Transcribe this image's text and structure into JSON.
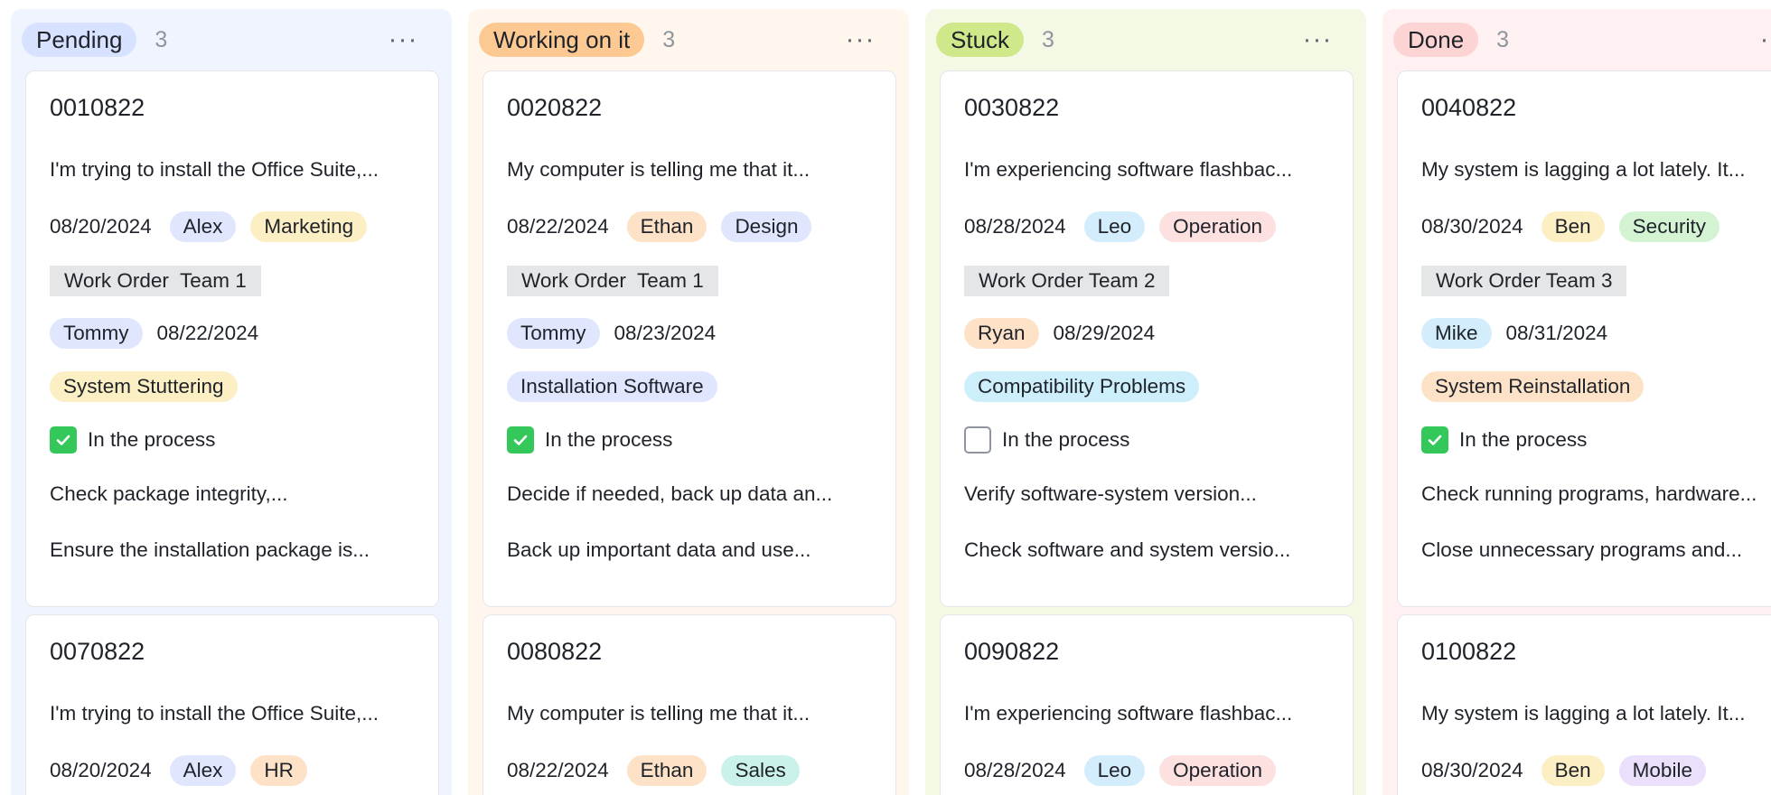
{
  "columns": [
    {
      "status": "Pending",
      "count": "3",
      "pill_color": "#d6e2ff",
      "bg_color": "#f0f4ff",
      "cards": [
        {
          "id": "0010822",
          "description": "I'm trying to install the Office Suite,...",
          "date": "08/20/2024",
          "assignee": {
            "name": "Alex",
            "color": "#dfe6fd"
          },
          "department": {
            "name": "Marketing",
            "color": "#fcefc4"
          },
          "work_order": "Work Order  Team 1",
          "handler": {
            "name": "Tommy",
            "color": "#dfe6fd"
          },
          "handler_date": "08/22/2024",
          "category": {
            "name": "System Stuttering",
            "color": "#fcefc4"
          },
          "process_checked": true,
          "process_label": "In the process",
          "step1": "Check package integrity,...",
          "step2": "Ensure the installation package is..."
        },
        {
          "id": "0070822",
          "description": "I'm trying to install the Office Suite,...",
          "date": "08/20/2024",
          "assignee": {
            "name": "Alex",
            "color": "#dfe6fd"
          },
          "department": {
            "name": "HR",
            "color": "#fde2c8"
          }
        }
      ]
    },
    {
      "status": "Working on it",
      "count": "3",
      "pill_color": "#fdc993",
      "bg_color": "#fff6ed",
      "cards": [
        {
          "id": "0020822",
          "description": "My computer is telling me that it...",
          "date": "08/22/2024",
          "assignee": {
            "name": "Ethan",
            "color": "#fde2c8"
          },
          "department": {
            "name": "Design",
            "color": "#dfe6fd"
          },
          "work_order": "Work Order  Team 1",
          "handler": {
            "name": "Tommy",
            "color": "#dfe6fd"
          },
          "handler_date": "08/23/2024",
          "category": {
            "name": "Installation Software",
            "color": "#dfe6fd"
          },
          "process_checked": true,
          "process_label": "In the process",
          "step1": "Decide if needed, back up data an...",
          "step2": "Back up important data and use..."
        },
        {
          "id": "0080822",
          "description": "My computer is telling me that it...",
          "date": "08/22/2024",
          "assignee": {
            "name": "Ethan",
            "color": "#fde2c8"
          },
          "department": {
            "name": "Sales",
            "color": "#caf2ea"
          }
        }
      ]
    },
    {
      "status": "Stuck",
      "count": "3",
      "pill_color": "#cfe88a",
      "bg_color": "#f4f9e6",
      "cards": [
        {
          "id": "0030822",
          "description": "I'm experiencing software flashbac...",
          "date": "08/28/2024",
          "assignee": {
            "name": "Leo",
            "color": "#d3edfc"
          },
          "department": {
            "name": "Operation",
            "color": "#fde0e0"
          },
          "work_order": "Work Order Team 2",
          "handler": {
            "name": "Ryan",
            "color": "#fde2c8"
          },
          "handler_date": "08/29/2024",
          "category": {
            "name": "Compatibility Problems",
            "color": "#cdeefb"
          },
          "process_checked": false,
          "process_label": "In the process",
          "step1": "Verify software-system version...",
          "step2": "Check software and system versio..."
        },
        {
          "id": "0090822",
          "description": "I'm experiencing software flashbac...",
          "date": "08/28/2024",
          "assignee": {
            "name": "Leo",
            "color": "#d3edfc"
          },
          "department": {
            "name": "Operation",
            "color": "#fde0e0"
          }
        }
      ]
    },
    {
      "status": "Done",
      "count": "3",
      "pill_color": "#fdd4d4",
      "bg_color": "#fff1f1",
      "cards": [
        {
          "id": "0040822",
          "description": "My system is lagging a lot lately. It...",
          "date": "08/30/2024",
          "assignee": {
            "name": "Ben",
            "color": "#fcefc4"
          },
          "department": {
            "name": "Security",
            "color": "#d3f3d3"
          },
          "work_order": "Work Order Team 3",
          "handler": {
            "name": "Mike",
            "color": "#d3edfc"
          },
          "handler_date": "08/31/2024",
          "category": {
            "name": "System Reinstallation",
            "color": "#fde2c8"
          },
          "process_checked": true,
          "process_label": "In the process",
          "step1": "Check running programs, hardware...",
          "step2": "Close unnecessary programs and..."
        },
        {
          "id": "0100822",
          "description": "My system is lagging a lot lately. It...",
          "date": "08/30/2024",
          "assignee": {
            "name": "Ben",
            "color": "#fcefc4"
          },
          "department": {
            "name": "Mobile",
            "color": "#ebe0fb"
          }
        }
      ]
    }
  ]
}
